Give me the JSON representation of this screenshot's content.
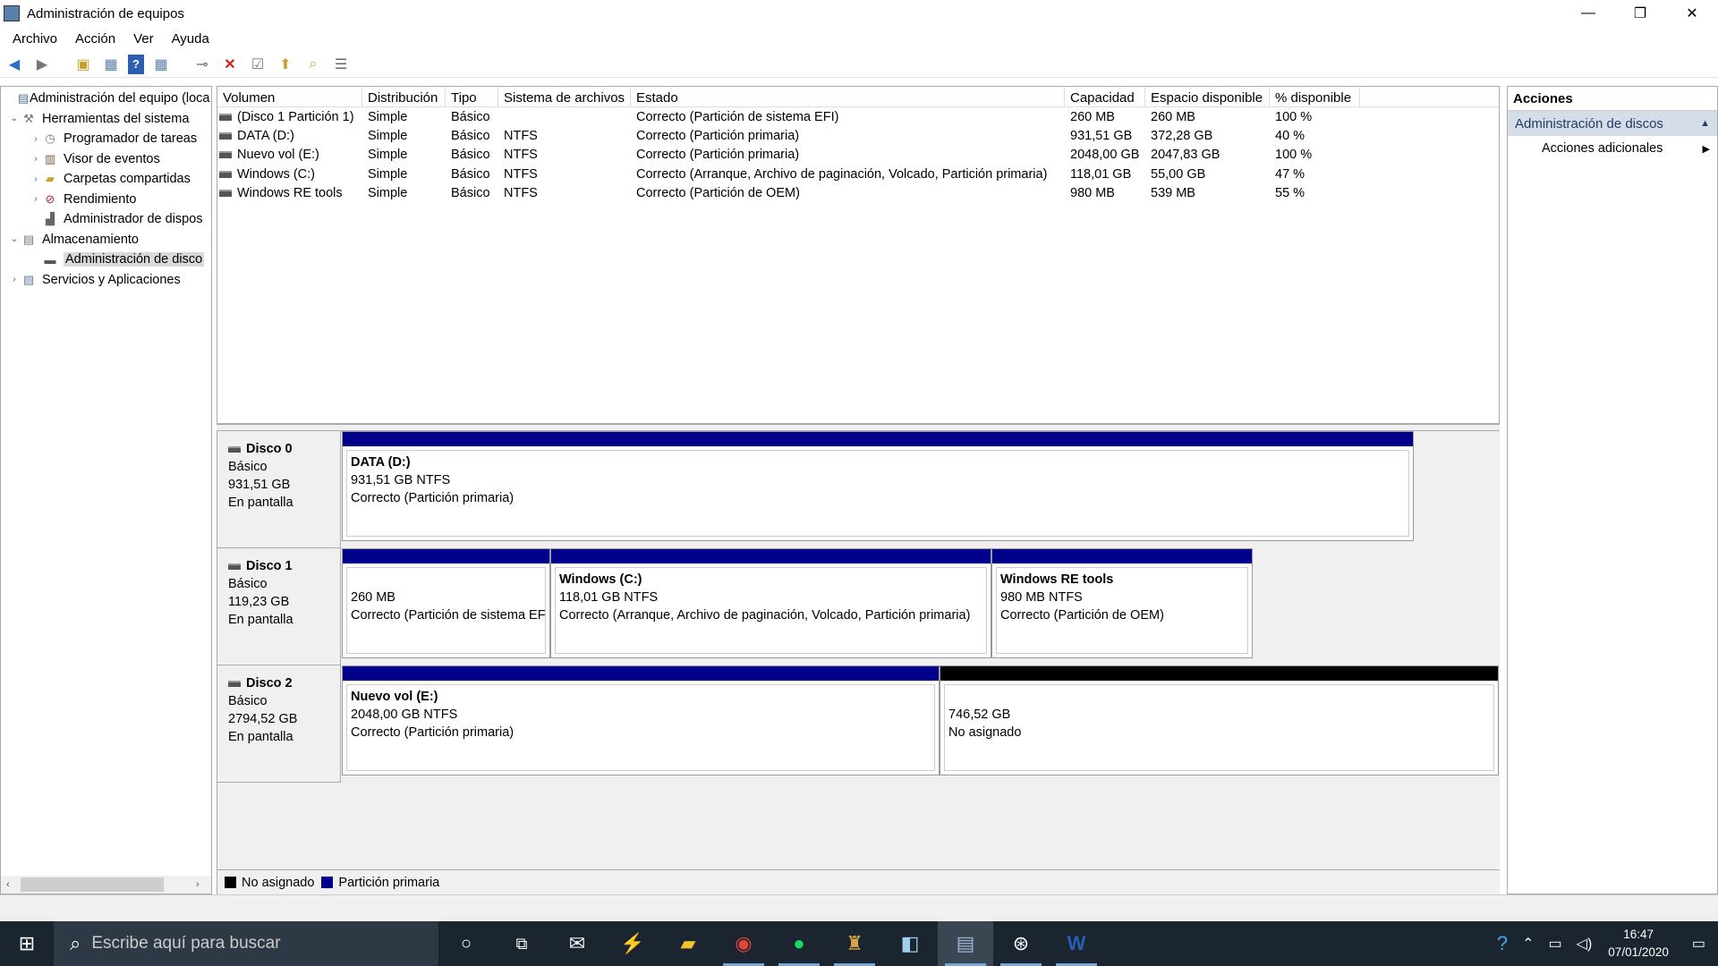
{
  "window": {
    "title": "Administración de equipos",
    "min": "—",
    "restore": "❐",
    "close": "✕"
  },
  "menu": [
    "Archivo",
    "Acción",
    "Ver",
    "Ayuda"
  ],
  "tree": {
    "items": [
      {
        "label": "Administración del equipo (loca",
        "level": 0,
        "exp": ""
      },
      {
        "label": "Herramientas del sistema",
        "level": 1,
        "exp": "⌄"
      },
      {
        "label": "Programador de tareas",
        "level": 2,
        "exp": "›"
      },
      {
        "label": "Visor de eventos",
        "level": 2,
        "exp": "›"
      },
      {
        "label": "Carpetas compartidas",
        "level": 2,
        "exp": "›"
      },
      {
        "label": "Rendimiento",
        "level": 2,
        "exp": "›"
      },
      {
        "label": "Administrador de dispos",
        "level": 2,
        "exp": ""
      },
      {
        "label": "Almacenamiento",
        "level": 1,
        "exp": "⌄"
      },
      {
        "label": "Administración de disco",
        "level": 2,
        "exp": "",
        "selected": true
      },
      {
        "label": "Servicios y Aplicaciones",
        "level": 1,
        "exp": "›"
      }
    ]
  },
  "table": {
    "headers": [
      "Volumen",
      "Distribución",
      "Tipo",
      "Sistema de archivos",
      "Estado",
      "Capacidad",
      "Espacio disponible",
      "% disponible"
    ],
    "rows": [
      [
        "(Disco 1 Partición 1)",
        "Simple",
        "Básico",
        "",
        "Correcto (Partición de sistema EFI)",
        "260 MB",
        "260 MB",
        "100 %"
      ],
      [
        "DATA (D:)",
        "Simple",
        "Básico",
        "NTFS",
        "Correcto (Partición primaria)",
        "931,51 GB",
        "372,28 GB",
        "40 %"
      ],
      [
        "Nuevo vol (E:)",
        "Simple",
        "Básico",
        "NTFS",
        "Correcto (Partición primaria)",
        "2048,00 GB",
        "2047,83 GB",
        "100 %"
      ],
      [
        "Windows (C:)",
        "Simple",
        "Básico",
        "NTFS",
        "Correcto (Arranque, Archivo de paginación, Volcado, Partición primaria)",
        "118,01 GB",
        "55,00 GB",
        "47 %"
      ],
      [
        "Windows RE tools",
        "Simple",
        "Básico",
        "NTFS",
        "Correcto (Partición de OEM)",
        "980 MB",
        "539 MB",
        "55 %"
      ]
    ]
  },
  "disks": [
    {
      "name": "Disco 0",
      "type": "Básico",
      "size": "931,51 GB",
      "state": "En pantalla",
      "parts": [
        {
          "label": "DATA  (D:)",
          "l2": "931,51 GB NTFS",
          "l3": "Correcto (Partición primaria)",
          "color": "primary"
        }
      ]
    },
    {
      "name": "Disco 1",
      "type": "Básico",
      "size": "119,23 GB",
      "state": "En pantalla",
      "parts": [
        {
          "label": "",
          "l2": "260 MB",
          "l3": "Correcto (Partición de sistema EFI)",
          "color": "primary"
        },
        {
          "label": "Windows  (C:)",
          "l2": "118,01 GB NTFS",
          "l3": "Correcto (Arranque, Archivo de paginación, Volcado, Partición primaria)",
          "color": "primary"
        },
        {
          "label": "Windows RE tools",
          "l2": "980 MB NTFS",
          "l3": "Correcto (Partición de OEM)",
          "color": "primary"
        }
      ]
    },
    {
      "name": "Disco 2",
      "type": "Básico",
      "size": "2794,52 GB",
      "state": "En pantalla",
      "parts": [
        {
          "label": "Nuevo vol  (E:)",
          "l2": "2048,00 GB NTFS",
          "l3": "Correcto (Partición primaria)",
          "color": "primary"
        },
        {
          "label": "",
          "l2": "746,52 GB",
          "l3": "No asignado",
          "color": "unallocated"
        }
      ]
    }
  ],
  "legend": {
    "unallocated": "No asignado",
    "primary": "Partición primaria"
  },
  "actions": {
    "header": "Acciones",
    "section": "Administración de discos",
    "item": "Acciones adicionales"
  },
  "taskbar": {
    "search_placeholder": "Escribe aquí para buscar",
    "time": "16:47",
    "date": "07/01/2020"
  },
  "colors": {
    "primary": "#00008b",
    "unallocated": "#000000",
    "taskbar": "#1b2530"
  }
}
